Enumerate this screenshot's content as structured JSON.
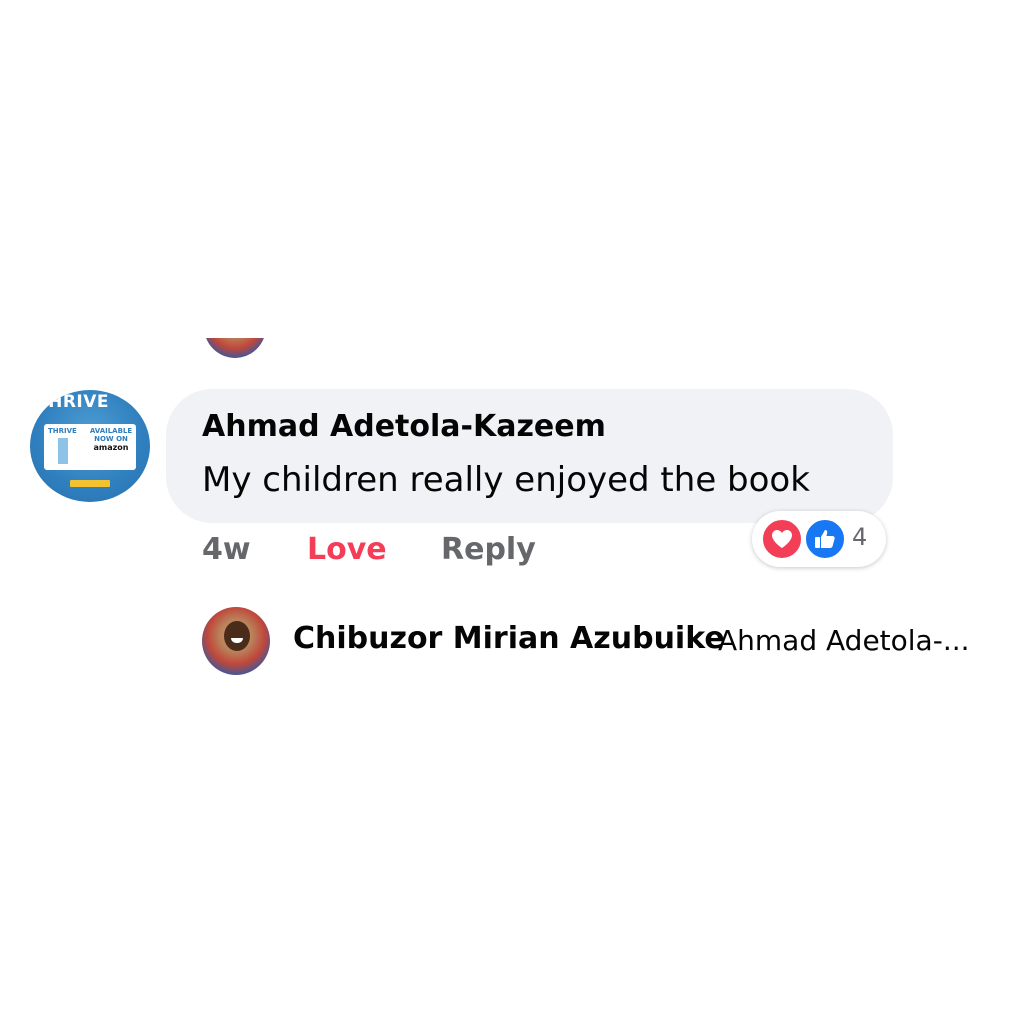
{
  "comment": {
    "author": "Ahmad Adetola-Kazeem",
    "text": "My children really enjoyed the book",
    "avatar_brand_text": "THRIVE",
    "avatar_card": {
      "brand_small": "THRIVE",
      "available_line1": "AVAILABLE",
      "available_line2": "NOW ON",
      "store": "amazon"
    },
    "time": "4w",
    "reaction_action": "Love",
    "reply_action": "Reply",
    "reaction_count": "4",
    "reaction_icons": [
      "heart-icon",
      "thumbs-up-icon"
    ],
    "colors": {
      "love": "#f33e58",
      "like": "#1877f2",
      "bubble": "#f0f2f5",
      "meta": "#65676b"
    }
  },
  "reply_preview": {
    "author": "Chibuzor Mirian Azubuike",
    "snippet": "Ahmad Adetola-..."
  }
}
